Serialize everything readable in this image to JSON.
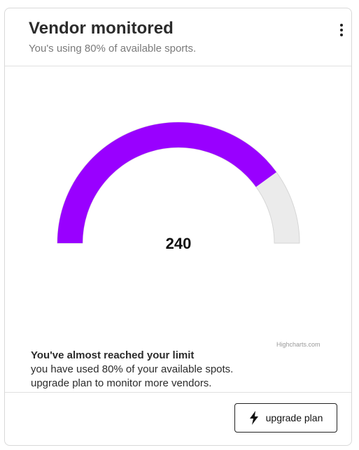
{
  "card": {
    "title": "Vendor monitored",
    "subtitle": "You's using 80% of available sports.",
    "menu_icon": "more-vertical-icon"
  },
  "gauge": {
    "value_label": "240",
    "fill_fraction": 0.8,
    "fill_color": "#9900ff",
    "track_color": "#ebebeb",
    "credits": "Highcharts.com"
  },
  "limit": {
    "title": "You've almost reached your limit",
    "line1": "you have used 80% of your available spots.",
    "line2": "upgrade plan to monitor more vendors."
  },
  "footer": {
    "button_label": "upgrade plan",
    "button_icon": "lightning-bolt-icon"
  }
}
